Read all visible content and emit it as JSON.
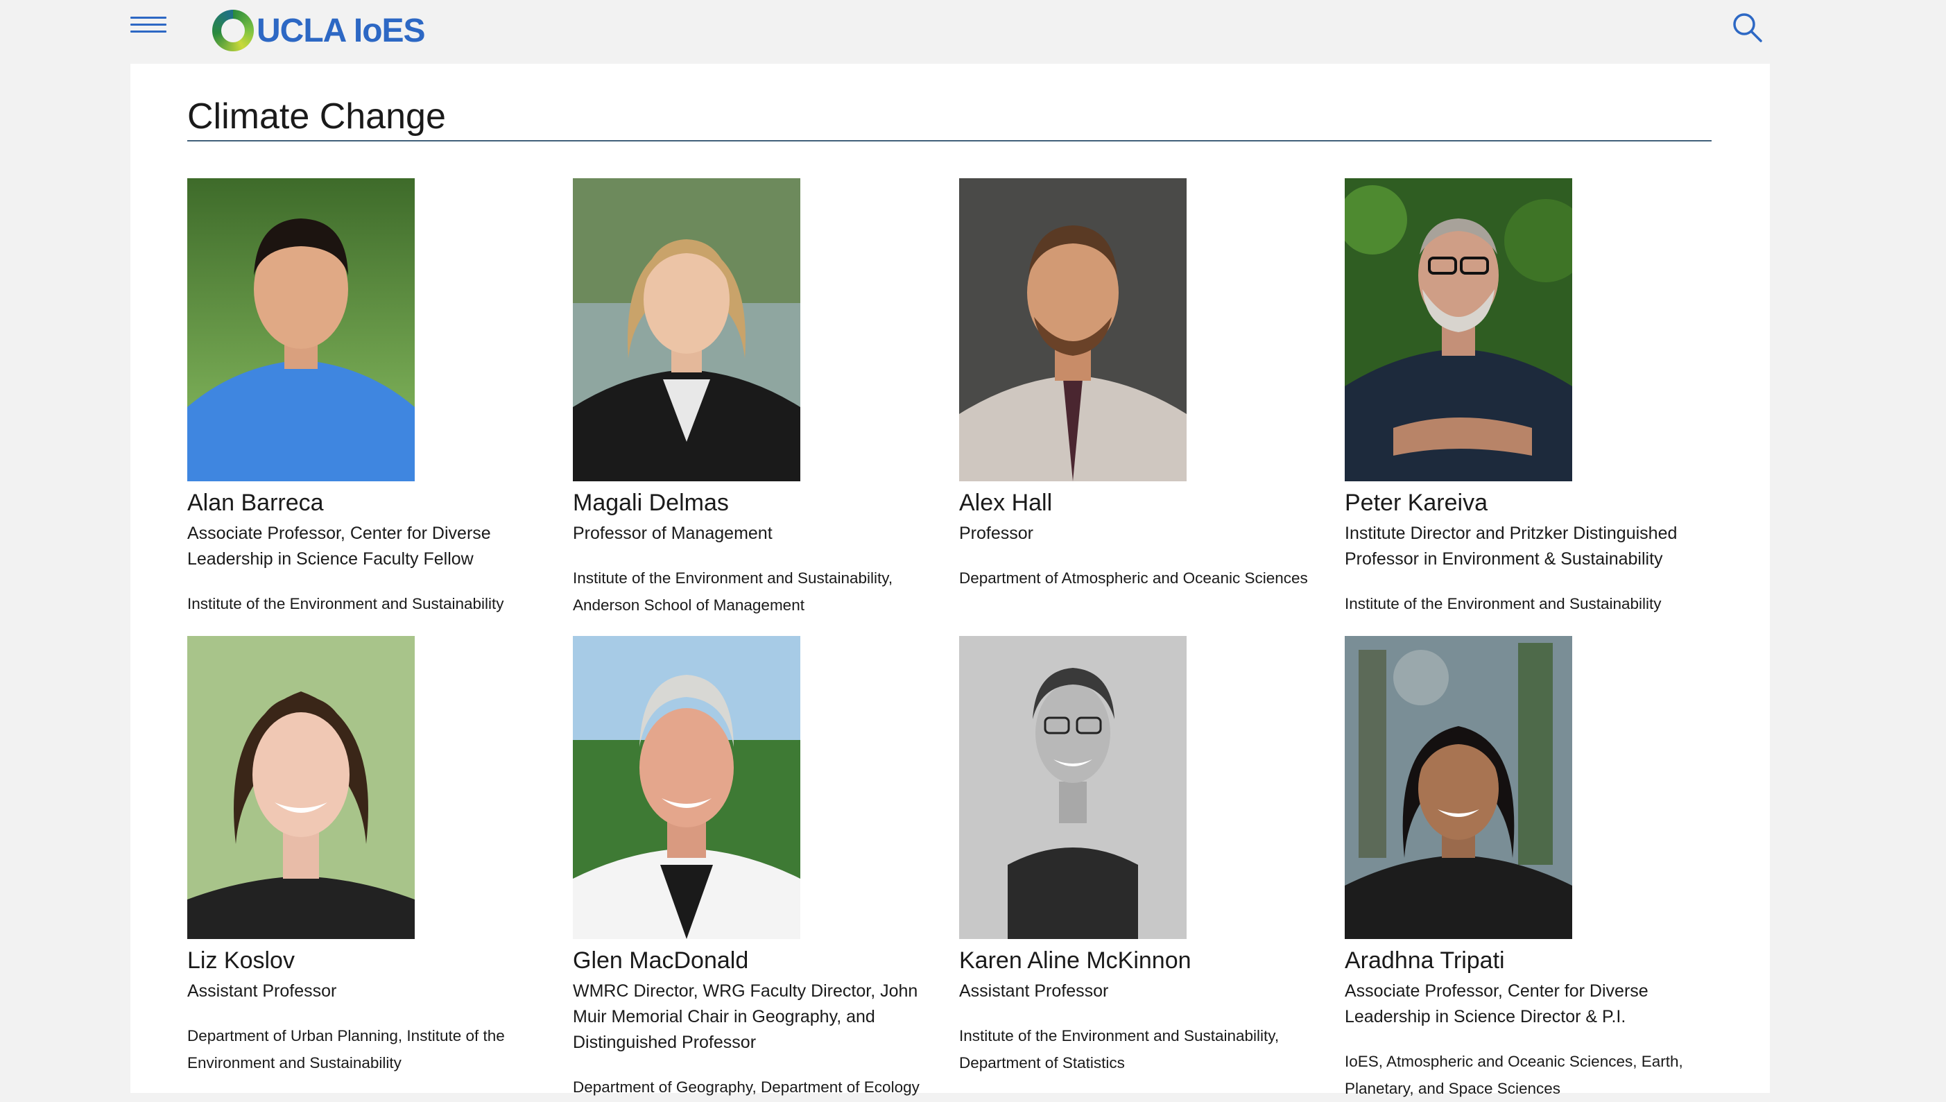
{
  "header": {
    "logo_ucla": "UCLA",
    "logo_ioes": "IoES"
  },
  "page": {
    "section_title": "Climate Change"
  },
  "people": [
    {
      "name": "Alan Barreca",
      "role": "Associate Professor, Center for Diverse Leadership in Science Faculty Fellow",
      "dept": "Institute of the Environment and Sustainability"
    },
    {
      "name": "Magali Delmas",
      "role": "Professor of Management",
      "dept": "Institute of the Environment and Sustainability, Anderson School of Management"
    },
    {
      "name": "Alex Hall",
      "role": "Professor",
      "dept": "Department of Atmospheric and Oceanic Sciences"
    },
    {
      "name": "Peter Kareiva",
      "role": "Institute Director and Pritzker Distinguished Professor in Environment & Sustainability",
      "dept": "Institute of the Environment and Sustainability"
    },
    {
      "name": "Liz Koslov",
      "role": "Assistant Professor",
      "dept": "Department of Urban Planning, Institute of the Environment and Sustainability"
    },
    {
      "name": "Glen MacDonald",
      "role": "WMRC Director, WRG Faculty Director, John Muir Memorial Chair in Geography, and Distinguished Professor",
      "dept": "Department of Geography, Department of Ecology"
    },
    {
      "name": "Karen Aline McKinnon",
      "role": "Assistant Professor",
      "dept": "Institute of the Environment and Sustainability, Department of Statistics"
    },
    {
      "name": "Aradhna Tripati",
      "role": "Associate Professor, Center for Diverse Leadership in Science Director & P.I.",
      "dept": "IoES, Atmospheric and Oceanic Sciences, Earth, Planetary, and Space Sciences"
    }
  ],
  "icons": {
    "menu": "hamburger-menu-icon",
    "search": "search-icon",
    "logo": "ioes-ring-logo"
  },
  "colors": {
    "brand_blue": "#2d68c4",
    "page_bg": "#f2f2f2",
    "rule": "#41607a"
  }
}
